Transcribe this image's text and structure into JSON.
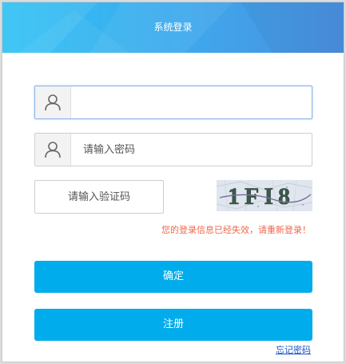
{
  "dialog": {
    "title": "系统登录"
  },
  "username": {
    "value": "",
    "placeholder": "",
    "icon": "user-icon"
  },
  "password": {
    "value": "",
    "placeholder": "请输入密码",
    "icon": "user-icon"
  },
  "captcha": {
    "placeholder": "请输入验证码",
    "image_text": "1FI8"
  },
  "error_message": "您的登录信息已经失效，请重新登录！",
  "buttons": {
    "confirm": "确定",
    "register": "注册"
  },
  "forgot_password": "忘记密码",
  "colors": {
    "accent": "#00acec",
    "header_start": "#2fc2f4",
    "header_end": "#4a8fe0",
    "error": "#f0674a",
    "link": "#1a55c8"
  }
}
